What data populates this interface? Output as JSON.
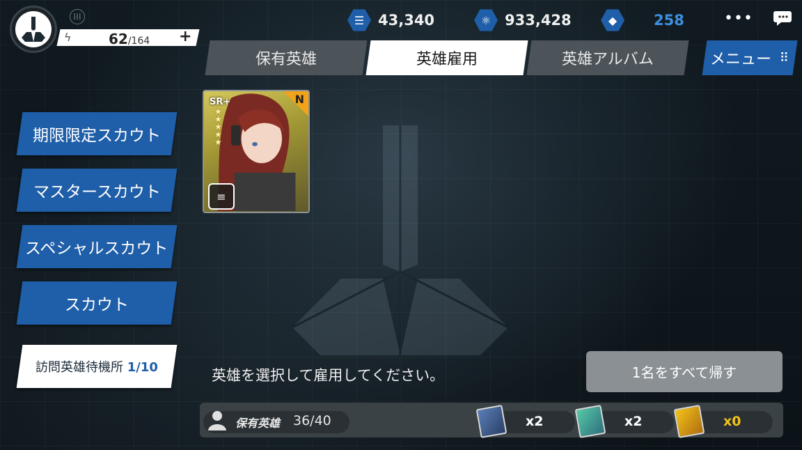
{
  "player": {
    "stamina_current": "62",
    "stamina_max": "/164",
    "plus": "+"
  },
  "currencies": [
    {
      "icon": "list-icon",
      "value": "43,340"
    },
    {
      "icon": "molecule-icon",
      "value": "933,428"
    },
    {
      "icon": "crystal-icon",
      "value": "258"
    }
  ],
  "header": {
    "more": "•••"
  },
  "tabs": [
    {
      "label": "保有英雄",
      "active": false
    },
    {
      "label": "英雄雇用",
      "active": true
    },
    {
      "label": "英雄アルバム",
      "active": false
    }
  ],
  "menu": {
    "label": "メニュー",
    "icon": "grid-icon"
  },
  "sidebar": [
    {
      "label": "期限限定スカウト"
    },
    {
      "label": "マスタースカウト"
    },
    {
      "label": "スペシャルスカウト"
    },
    {
      "label": "スカウト"
    }
  ],
  "visitor": {
    "label": "訪問英雄待機所",
    "count": "1/10"
  },
  "hero": {
    "rarity": "SR+",
    "rank": "N",
    "stars": 5
  },
  "instruction": "英雄を選択して雇用してください。",
  "return_button": "1名をすべて帰す",
  "footer": {
    "owned_label": "保有英雄",
    "owned_count": "36/40",
    "tickets": [
      {
        "color": "blue",
        "count": "x2"
      },
      {
        "color": "green",
        "count": "x2"
      },
      {
        "color": "gold",
        "count": "x0"
      }
    ]
  },
  "colors": {
    "accent": "#1f5ea8",
    "tab_inactive": "#4c5459",
    "gold": "#f2c31a"
  }
}
